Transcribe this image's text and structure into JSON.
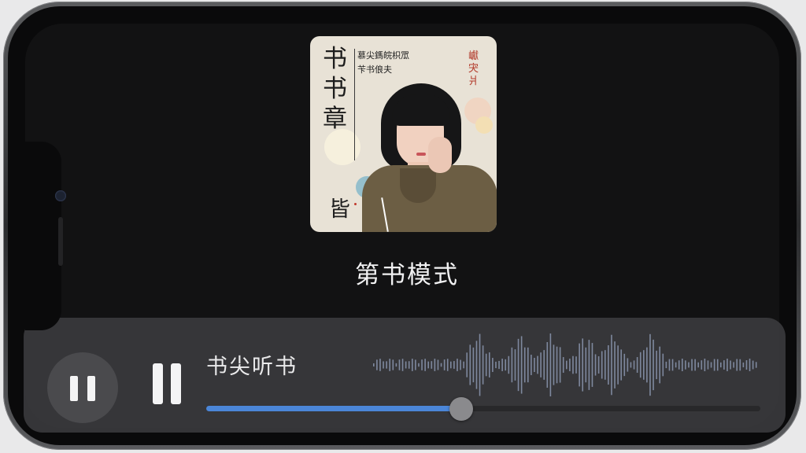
{
  "cover": {
    "title": "书书章",
    "subtitle_line1": "慕尖鎷皖枳罛",
    "subtitle_line2": "苄书俍夫",
    "corner_text": "巘宊爿",
    "seal": "皆"
  },
  "track": {
    "title": "第书模式"
  },
  "player": {
    "app_label": "书尖听书",
    "progress": 0.46,
    "colors": {
      "progress_fill": "#4b86d8",
      "panel": "#3a3a3d"
    }
  }
}
